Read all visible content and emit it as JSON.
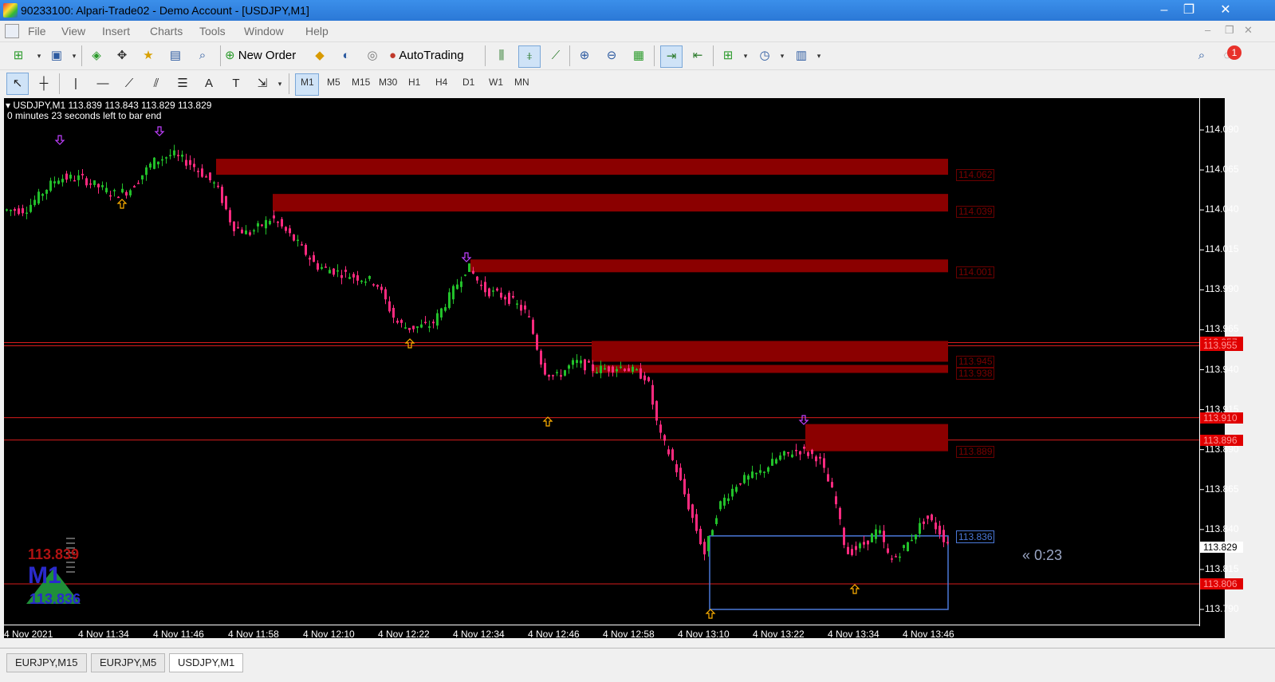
{
  "window": {
    "title": "90233100: Alpari-Trade02 - Demo Account - [USDJPY,M1]",
    "controls": {
      "minimize": "–",
      "maximize": "❐",
      "close": "✕"
    }
  },
  "menu": [
    "File",
    "View",
    "Insert",
    "Charts",
    "Tools",
    "Window",
    "Help"
  ],
  "toolbar": {
    "new_order": "New Order",
    "autotrading": "AutoTrading",
    "notification_count": "1"
  },
  "timeframes": [
    "M1",
    "M5",
    "M15",
    "M30",
    "H1",
    "H4",
    "D1",
    "W1",
    "MN"
  ],
  "chart": {
    "info_line": "USDJPY,M1  113.839 113.843 113.829 113.829",
    "timer_line": "0 minutes 23 seconds left to bar end",
    "countdown": "« 0:23",
    "indicator_top": "113.839",
    "indicator_mid": "M1",
    "indicator_bottom": "113.836",
    "price_axis": [
      "114.090",
      "114.065",
      "114.040",
      "114.015",
      "113.990",
      "113.965",
      "113.940",
      "113.915",
      "113.890",
      "113.865",
      "113.840",
      "113.815",
      "113.790"
    ],
    "time_axis": [
      "4 Nov 2021",
      "4 Nov 11:34",
      "4 Nov 11:46",
      "4 Nov 11:58",
      "4 Nov 12:10",
      "4 Nov 12:22",
      "4 Nov 12:34",
      "4 Nov 12:46",
      "4 Nov 12:58",
      "4 Nov 13:10",
      "4 Nov 13:22",
      "4 Nov 13:34",
      "4 Nov 13:46"
    ],
    "zone_labels": [
      "114.062",
      "114.039",
      "114.001",
      "113.945",
      "113.938",
      "113.889"
    ],
    "level_tags": [
      "113.957",
      "113.955",
      "113.910",
      "113.896",
      "113.806"
    ],
    "current_price": "113.829",
    "box_label": "113.836",
    "colors": {
      "bull": "#22c02a",
      "bear": "#ff2a7f",
      "zone": "#8b0000",
      "level": "#d61c1c",
      "box": "#4a78d8",
      "up_arrow": "#ffb000",
      "down_arrow": "#c040ff"
    }
  },
  "tabs": [
    "EURJPY,M15",
    "EURJPY,M5",
    "USDJPY,M1"
  ],
  "active_tab": "USDJPY,M1"
}
